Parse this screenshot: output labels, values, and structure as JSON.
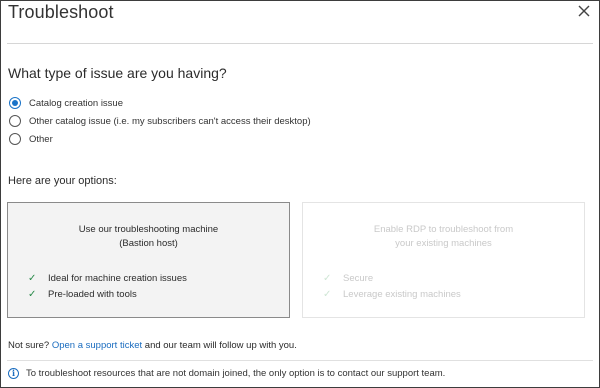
{
  "dialog": {
    "title": "Troubleshoot",
    "close_label": "×"
  },
  "question": {
    "label": "What type of issue are you having?",
    "options": [
      {
        "label": "Catalog creation issue",
        "selected": true
      },
      {
        "label": "Other catalog issue (i.e. my subscribers can't access their desktop)",
        "selected": false
      },
      {
        "label": "Other",
        "selected": false
      }
    ]
  },
  "options": {
    "heading": "Here are your options:",
    "cards": [
      {
        "title_line1": "Use our troubleshooting machine",
        "title_line2": "(Bastion host)",
        "items": [
          "Ideal for machine creation issues",
          "Pre-loaded with tools"
        ],
        "enabled": true
      },
      {
        "title_line1": "Enable RDP to troubleshoot from",
        "title_line2": "your existing machines",
        "items": [
          "Secure",
          "Leverage existing machines"
        ],
        "enabled": false
      }
    ]
  },
  "footer": {
    "prefix": "Not sure? ",
    "link": "Open a support ticket",
    "suffix": " and our team will follow up with you."
  },
  "info": {
    "icon": "i",
    "text": "To troubleshoot resources that are not domain joined, the only option is to contact our support team."
  },
  "colors": {
    "accent": "#1a73c8",
    "link": "#1a6cbf",
    "check": "#2a8a4a"
  },
  "icons": {
    "close": "close-icon",
    "check": "check-icon",
    "info": "info-icon"
  }
}
